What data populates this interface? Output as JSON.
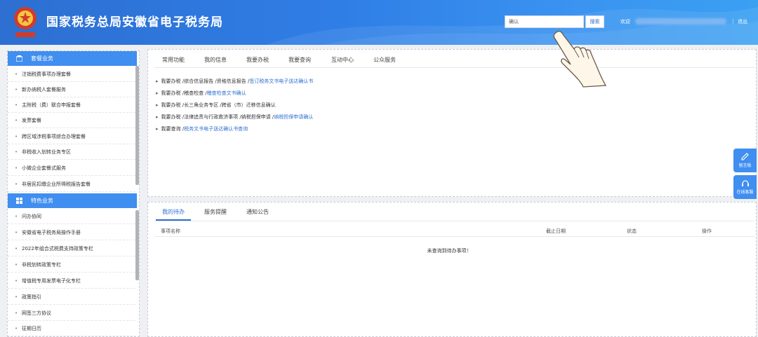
{
  "header": {
    "title": "国家税务总局安徽省电子税务局",
    "search_value": "确认",
    "search_button": "搜索",
    "welcome": "欢迎",
    "separator": "|",
    "logout": "退出"
  },
  "sidebar": {
    "section1": {
      "label": "套餐业务",
      "items": [
        "注销税费事项办理套餐",
        "新办纳税人套餐服务",
        "主附税（费）联合申报套餐",
        "发票套餐",
        "跨区域涉税事项综合办理套餐",
        "非税收入划转业务专区",
        "小微企业套餐式服务",
        "非居民扣缴企业所得税报告套餐"
      ]
    },
    "section2": {
      "label": "特色业务",
      "items": [
        "问办协同",
        "安徽省电子税务局操作手册",
        "2022年组合式税费支持政策专栏",
        "非税划转政策专栏",
        "增值税专用发票电子化专栏",
        "政策指引",
        "网签三方协议",
        "征期日历"
      ]
    }
  },
  "main": {
    "tabs": [
      "常用功能",
      "我的信息",
      "我要办税",
      "我要查询",
      "互动中心",
      "公众服务"
    ],
    "links": [
      {
        "prefix": "我要办税 /综合信息报告 /资格信息报告 /",
        "target": "签订税务文书电子送达确认书"
      },
      {
        "prefix": "我要办税 /稽查检查 /",
        "target": "稽查检查文书确认"
      },
      {
        "prefix": "我要办税 /长三角业务专区 /跨省（市）迁移信息确认",
        "target": ""
      },
      {
        "prefix": "我要办税 /法律追责与行政救济事项 /纳税担保申请 /",
        "target": "纳税担保申请确认"
      },
      {
        "prefix": "我要查询 /",
        "target": "税务文书电子送达确认书查询"
      }
    ]
  },
  "todo": {
    "tabs": [
      "我的待办",
      "服务提醒",
      "通知公告"
    ],
    "columns": [
      "事项名称",
      "截止日期",
      "状态",
      "操作"
    ],
    "empty": "未查询到待办事项！"
  },
  "float": {
    "btn1": "留言板",
    "btn2": "在线客服"
  },
  "colors": {
    "primary": "#2d6fd1",
    "accent": "#3f8ef0"
  }
}
